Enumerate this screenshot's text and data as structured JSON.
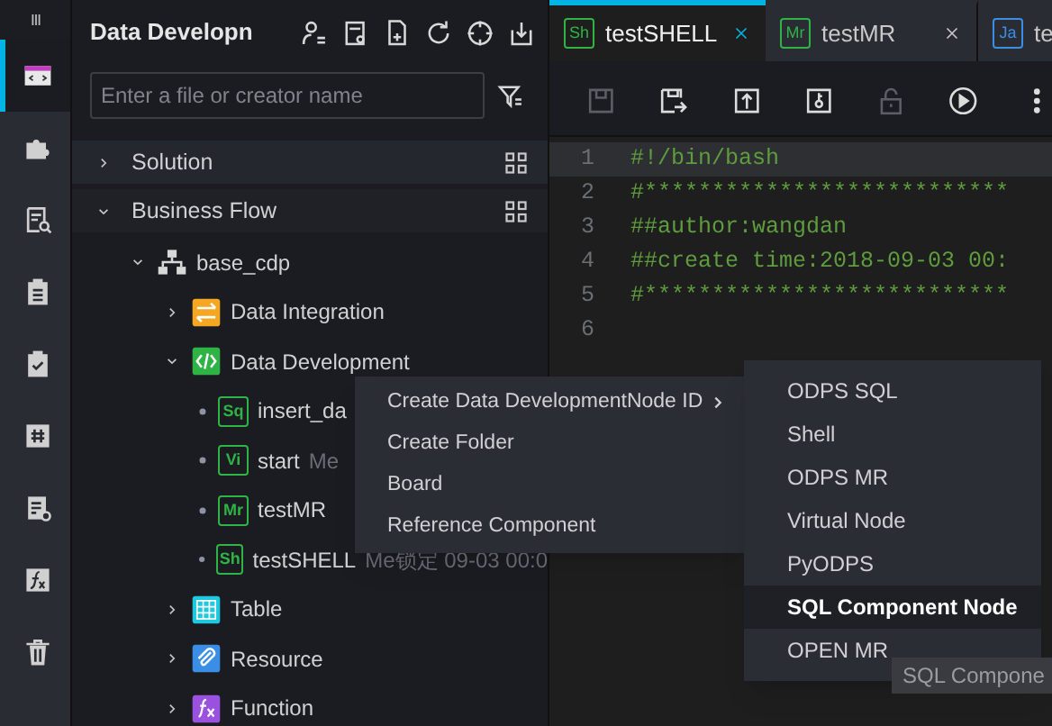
{
  "rail": {
    "items": [
      {
        "kind": "code",
        "selected": true
      },
      {
        "kind": "puzzle",
        "selected": false
      },
      {
        "kind": "doc-search",
        "selected": false
      },
      {
        "kind": "clipboard",
        "selected": false
      },
      {
        "kind": "clipboard-check",
        "selected": false
      },
      {
        "kind": "hash",
        "selected": false
      },
      {
        "kind": "doc-gear",
        "selected": false
      },
      {
        "kind": "fx",
        "selected": false
      },
      {
        "kind": "trash",
        "selected": false
      }
    ]
  },
  "sidebar": {
    "title": "Data Developn",
    "search": {
      "placeholder": "Enter a file or creator name"
    },
    "sections": [
      {
        "label": "Solution",
        "expanded": false
      },
      {
        "label": "Business Flow",
        "expanded": true,
        "children": [
          {
            "label": "base_cdp",
            "kind": "flow",
            "expanded": true,
            "children": [
              {
                "label": "Data Integration",
                "kind": "integration",
                "expanded": false
              },
              {
                "label": "Data Development",
                "kind": "development",
                "expanded": true,
                "children": [
                  {
                    "label": "insert_da",
                    "kind": "node",
                    "badge": "Sq"
                  },
                  {
                    "label": "start",
                    "kind": "node",
                    "badge": "Vi",
                    "meta": "Me"
                  },
                  {
                    "label": "testMR",
                    "kind": "node",
                    "badge": "Mr"
                  },
                  {
                    "label": "testSHELL",
                    "kind": "node",
                    "badge": "Sh",
                    "meta": "Me锁定 09-03 00:0"
                  }
                ]
              },
              {
                "label": "Table",
                "kind": "table",
                "expanded": false
              },
              {
                "label": "Resource",
                "kind": "resource",
                "expanded": false
              },
              {
                "label": "Function",
                "kind": "function",
                "expanded": false
              }
            ]
          }
        ]
      }
    ]
  },
  "editor": {
    "tabs": [
      {
        "badge": "Sh",
        "label": "testSHELL",
        "selected": true,
        "closable": true
      },
      {
        "badge": "Mr",
        "label": "testMR",
        "selected": false,
        "closable": true
      },
      {
        "badge": "Ja",
        "label": "te",
        "selected": false,
        "closable": false
      }
    ],
    "toolbar": [
      {
        "kind": "save",
        "disabled": true
      },
      {
        "kind": "save-as",
        "disabled": false
      },
      {
        "kind": "submit",
        "disabled": false
      },
      {
        "kind": "key",
        "disabled": false
      },
      {
        "kind": "lock",
        "disabled": true
      },
      {
        "kind": "run",
        "disabled": false
      },
      {
        "kind": "more",
        "disabled": false
      }
    ],
    "lines": [
      {
        "number": "1",
        "text": "#!/bin/bash",
        "active": true
      },
      {
        "number": "2",
        "text": "#***************************",
        "active": false
      },
      {
        "number": "3",
        "text": "##author:wangdan",
        "active": false
      },
      {
        "number": "4",
        "text": "##create time:2018-09-03 00:",
        "active": false
      },
      {
        "number": "5",
        "text": "#***************************",
        "active": false
      },
      {
        "number": "6",
        "active": false
      }
    ]
  },
  "context_menu": {
    "items": [
      {
        "label": "Create Data DevelopmentNode ID",
        "submenu": true
      },
      {
        "label": "Create Folder",
        "submenu": false
      },
      {
        "label": "Board",
        "submenu": false
      },
      {
        "label": "Reference Component",
        "submenu": false
      }
    ]
  },
  "submenu": {
    "items": [
      {
        "label": "ODPS SQL",
        "selected": false
      },
      {
        "label": "Shell",
        "selected": false
      },
      {
        "label": "ODPS MR",
        "selected": false
      },
      {
        "label": "Virtual Node",
        "selected": false
      },
      {
        "label": "PyODPS",
        "selected": false
      },
      {
        "label": "SQL Component Node",
        "selected": true
      },
      {
        "label": "OPEN MR",
        "selected": false
      }
    ]
  },
  "tooltip": {
    "text": "SQL Compone"
  }
}
